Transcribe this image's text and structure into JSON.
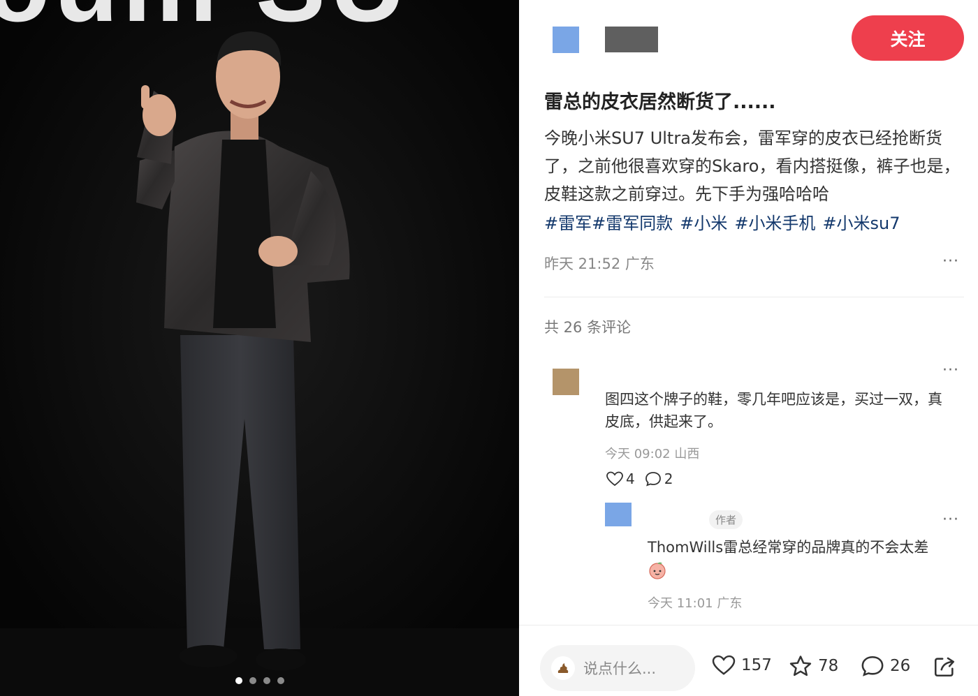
{
  "photo": {
    "background_text": "SU"
  },
  "carousel": {
    "count": 4,
    "active": 0
  },
  "header": {
    "follow_label": "关注"
  },
  "post": {
    "title": "雷总的皮衣居然断货了......",
    "body": "今晚小米SU7 Ultra发布会，雷军穿的皮衣已经抢断货了，之前他很喜欢穿的Skaro，看内搭挺像，裤子也是，皮鞋这款之前穿过。先下手为强哈哈哈",
    "tags": [
      "#雷军",
      "#雷军同款",
      "#小米",
      "#小米手机",
      "#小米su7"
    ],
    "meta": "昨天 21:52 广东",
    "more": "···"
  },
  "comments": {
    "count_label": "共 26 条评论",
    "items": [
      {
        "text": "图四这个牌子的鞋，零几年吧应该是，买过一双，真皮底，供起来了。",
        "meta": "今天 09:02 山西",
        "likes": "4",
        "replies": "2",
        "more": "···"
      }
    ],
    "reply": {
      "badge": "作者",
      "text": "ThomWills雷总经常穿的品牌真的不会太差",
      "meta": "今天 11:01 广东",
      "more": "···",
      "emoji_icon": "peach-emoji-icon"
    }
  },
  "bottom_bar": {
    "placeholder": "说点什么...",
    "likes": "157",
    "favorites": "78",
    "comments": "26"
  },
  "colors": {
    "accent": "#ee3f4d",
    "tag": "#13386c",
    "muted": "#888888"
  }
}
